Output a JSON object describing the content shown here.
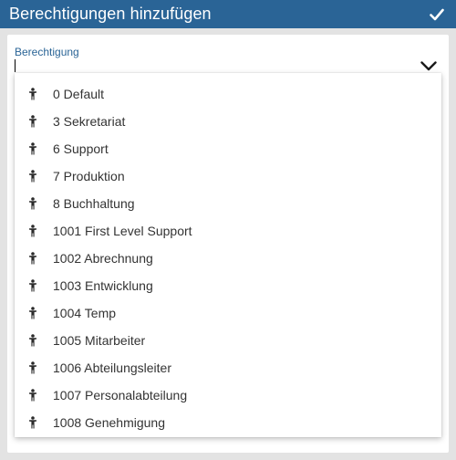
{
  "dialog": {
    "title": "Berechtigungen hinzufügen",
    "confirm_icon": "check-icon"
  },
  "field": {
    "label": "Berechtigung",
    "value": "",
    "dropdown_icon": "chevron-down-icon"
  },
  "options": [
    {
      "label": "0 Default",
      "icon": "person-icon"
    },
    {
      "label": "3 Sekretariat",
      "icon": "person-icon"
    },
    {
      "label": "6 Support",
      "icon": "person-icon"
    },
    {
      "label": "7 Produktion",
      "icon": "person-icon"
    },
    {
      "label": "8 Buchhaltung",
      "icon": "person-icon"
    },
    {
      "label": "1001 First Level Support",
      "icon": "person-icon"
    },
    {
      "label": "1002 Abrechnung",
      "icon": "person-icon"
    },
    {
      "label": "1003 Entwicklung",
      "icon": "person-icon"
    },
    {
      "label": "1004 Temp",
      "icon": "person-icon"
    },
    {
      "label": "1005 Mitarbeiter",
      "icon": "person-icon"
    },
    {
      "label": "1006 Abteilungsleiter",
      "icon": "person-icon"
    },
    {
      "label": "1007 Personalabteilung",
      "icon": "person-icon"
    },
    {
      "label": "1008 Genehmigung",
      "icon": "person-icon"
    }
  ],
  "colors": {
    "header": "#2a6496",
    "accent_label": "#2a6496",
    "background": "#e3e3e3"
  }
}
